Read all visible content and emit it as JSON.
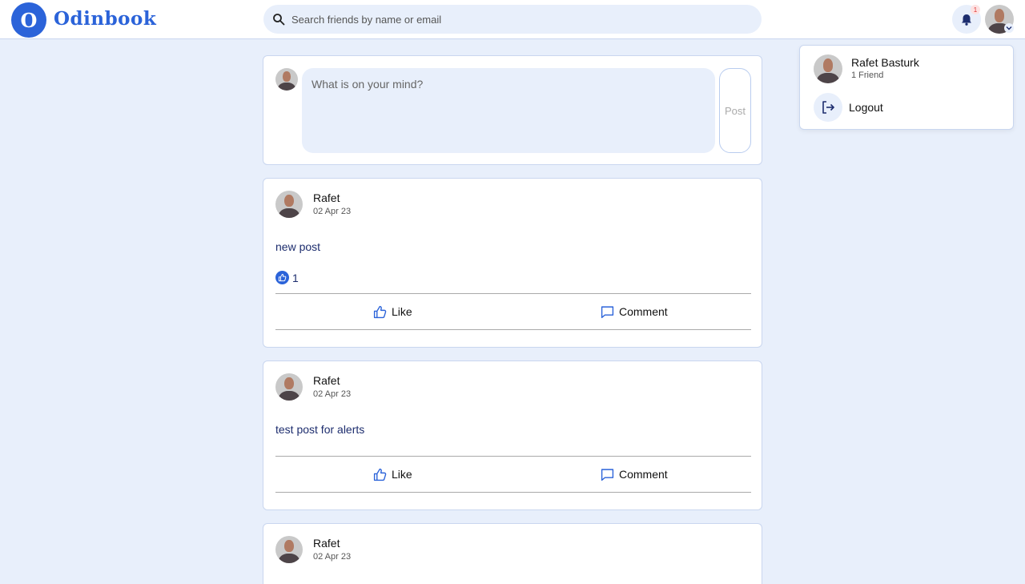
{
  "header": {
    "logo_letter": "O",
    "logo_text": "Odinbook",
    "search_placeholder": "Search friends by name or email",
    "notification_count": "1"
  },
  "dropdown": {
    "name": "Rafet Basturk",
    "friends": "1 Friend",
    "logout_label": "Logout"
  },
  "composer": {
    "placeholder": "What is on your mind?",
    "post_label": "Post"
  },
  "posts": [
    {
      "author": "Rafet",
      "date": "02 Apr 23",
      "body": "new post",
      "like_count": "1",
      "like_label": "Like",
      "comment_label": "Comment"
    },
    {
      "author": "Rafet",
      "date": "02 Apr 23",
      "body": "test post for alerts",
      "like_label": "Like",
      "comment_label": "Comment"
    },
    {
      "author": "Rafet",
      "date": "02 Apr 23"
    }
  ],
  "colors": {
    "brand": "#2b63d9",
    "background": "#e8effb",
    "post_text": "#1d2d6e"
  },
  "icons": [
    "search-icon",
    "bell-icon",
    "chevron-down-icon",
    "logout-icon",
    "thumbs-up-icon",
    "comment-icon"
  ]
}
